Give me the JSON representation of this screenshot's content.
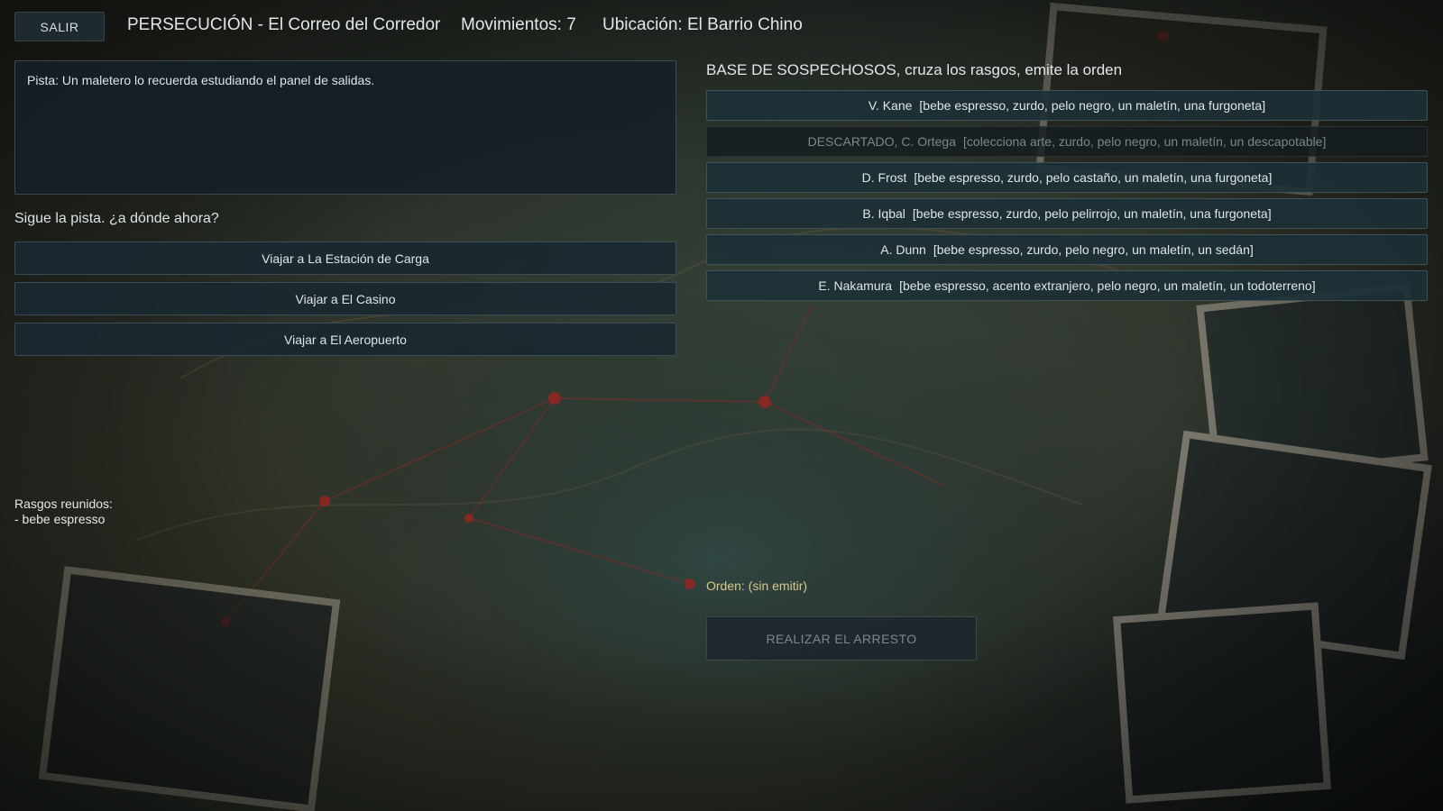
{
  "header": {
    "exit_label": "SALIR",
    "title": "PERSECUCIÓN - El Correo del Corredor",
    "moves": "Movimientos: 7",
    "location": "Ubicación: El Barrio Chino"
  },
  "clue": {
    "text": "Pista: Un maletero lo recuerda estudiando el panel de salidas."
  },
  "travel": {
    "prompt": "Sigue la pista. ¿a dónde ahora?",
    "options": [
      {
        "label": "Viajar a La Estación de Carga"
      },
      {
        "label": "Viajar a El Casino"
      },
      {
        "label": "Viajar a El Aeropuerto"
      }
    ]
  },
  "traits": {
    "heading": "Rasgos reunidos:",
    "items": [
      "- bebe espresso"
    ]
  },
  "suspects": {
    "heading": "BASE DE SOSPECHOSOS, cruza los rasgos, emite la orden",
    "rows": [
      {
        "name": "V. Kane",
        "traits": "[bebe espresso, zurdo, pelo negro, un maletín, una furgoneta]",
        "discarded": false
      },
      {
        "name": "DESCARTADO, C. Ortega",
        "traits": "[colecciona arte, zurdo, pelo negro, un maletín, un descapotable]",
        "discarded": true
      },
      {
        "name": "D. Frost",
        "traits": "[bebe espresso, zurdo, pelo castaño, un maletín, una furgoneta]",
        "discarded": false
      },
      {
        "name": "B. Iqbal",
        "traits": "[bebe espresso, zurdo, pelo pelirrojo, un maletín, una furgoneta]",
        "discarded": false
      },
      {
        "name": "A. Dunn",
        "traits": "[bebe espresso, zurdo, pelo negro, un maletín, un sedán]",
        "discarded": false
      },
      {
        "name": "E. Nakamura",
        "traits": "[bebe espresso, acento extranjero, pelo negro, un maletín, un todoterreno]",
        "discarded": false
      }
    ]
  },
  "warrant": {
    "text": "Orden: (sin emitir)"
  },
  "arrest": {
    "label": "REALIZAR EL ARRESTO",
    "enabled": false
  },
  "colors": {
    "accent_warrant": "#d8c88c",
    "button_bg": "#1a2830",
    "suspect_bg": "#1c3036"
  }
}
